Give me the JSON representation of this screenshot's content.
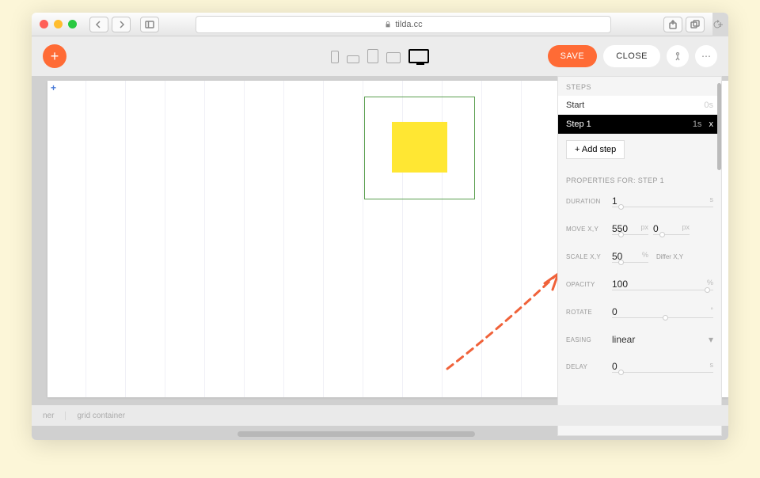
{
  "browser": {
    "url": "tilda.cc"
  },
  "toolbar": {
    "save": "SAVE",
    "close": "CLOSE"
  },
  "panel": {
    "steps_header": "STEPS",
    "start_label": "Start",
    "start_time": "0s",
    "step1_label": "Step 1",
    "step1_time": "1s",
    "step1_x": "x",
    "add_step": "+ Add step",
    "props_title": "PROPERTIES FOR: STEP 1",
    "duration_label": "DURATION",
    "duration_val": "1",
    "duration_unit": "s",
    "move_label": "MOVE X,Y",
    "move_x": "550",
    "move_y": "0",
    "move_unit": "px",
    "scale_label": "SCALE X,Y",
    "scale_val": "50",
    "scale_unit": "%",
    "scale_differ": "Differ X,Y",
    "opacity_label": "OPACITY",
    "opacity_val": "100",
    "opacity_unit": "%",
    "rotate_label": "ROTATE",
    "rotate_val": "0",
    "rotate_unit": "°",
    "easing_label": "EASING",
    "easing_val": "linear",
    "delay_label": "DELAY",
    "delay_val": "0",
    "delay_unit": "s"
  },
  "footer": {
    "item1": "ner",
    "item2": "grid container"
  }
}
